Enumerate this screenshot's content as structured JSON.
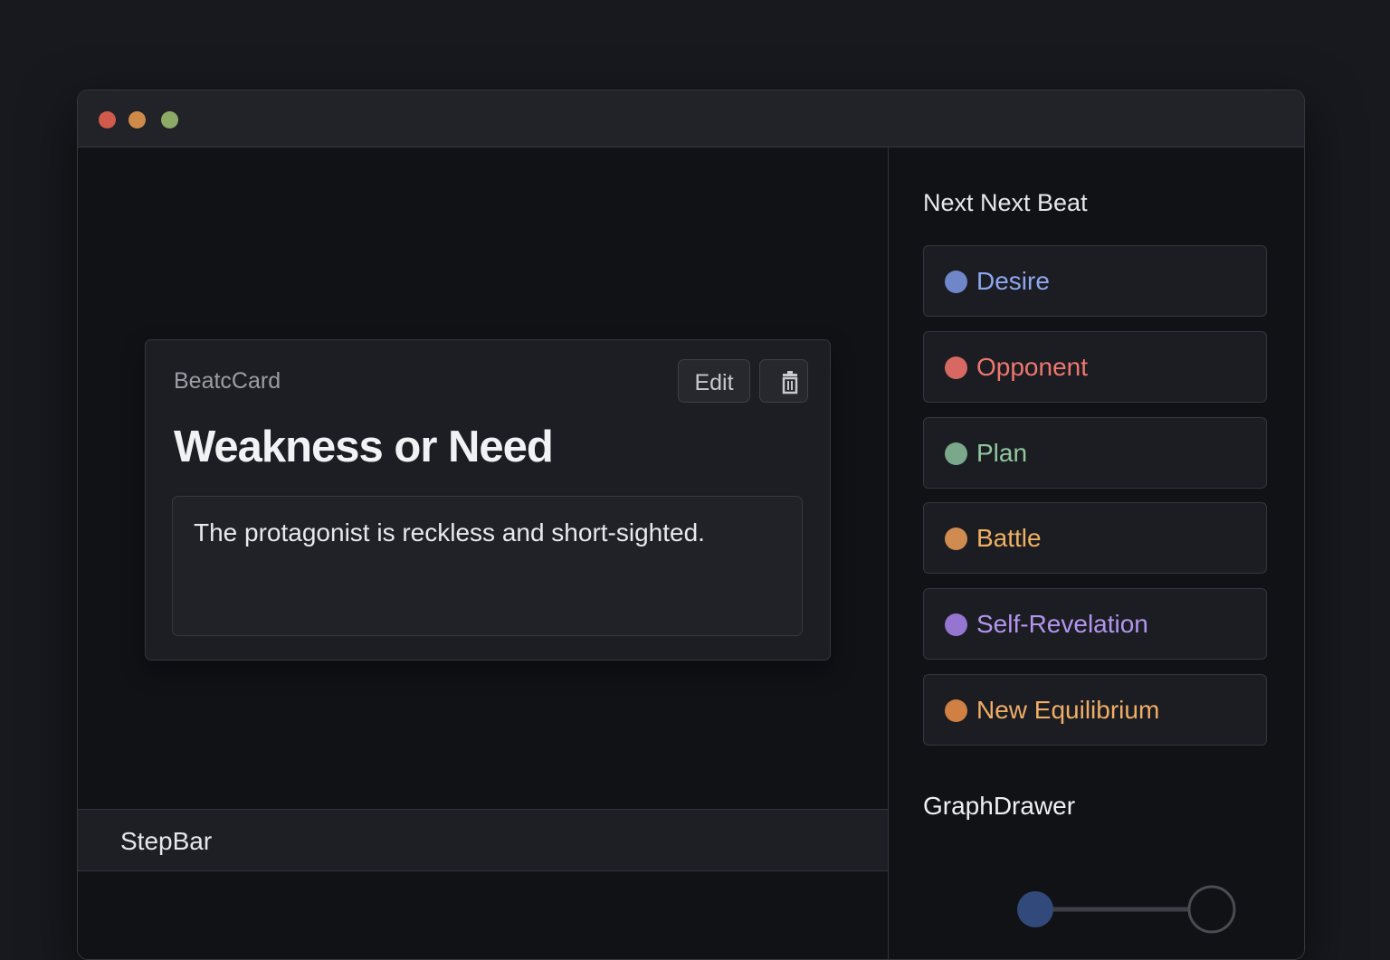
{
  "window": {
    "controls": [
      "close",
      "minimize",
      "maximize"
    ],
    "colors": {
      "close": "#d05a4c",
      "minimize": "#cf8a49",
      "maximize": "#8eaa67"
    }
  },
  "card": {
    "label": "BeatcCard",
    "edit_label": "Edit",
    "delete_icon": "trash-icon",
    "title": "Weakness or Need",
    "text": "The protagonist is reckless and short-sighted."
  },
  "stepbar": {
    "label": "StepBar"
  },
  "sidebar": {
    "title": "Next Next Beat",
    "items": [
      {
        "label": "Desire",
        "dot_color": "#6f87c9",
        "text_color": "#8ea6ef"
      },
      {
        "label": "Opponent",
        "dot_color": "#d86862",
        "text_color": "#ef7770"
      },
      {
        "label": "Plan",
        "dot_color": "#79a98a",
        "text_color": "#91c79e"
      },
      {
        "label": "Battle",
        "dot_color": "#d08c50",
        "text_color": "#f0b062"
      },
      {
        "label": "Self-Revelation",
        "dot_color": "#9475cf",
        "text_color": "#b395ee"
      },
      {
        "label": "New Equilibrium",
        "dot_color": "#cf8042",
        "text_color": "#f0ad67"
      }
    ]
  },
  "graph": {
    "title": "GraphDrawer",
    "colors": {
      "filled_node": "#314a7b",
      "empty_node_border": "#4a4c52",
      "edge": "#3e4046"
    }
  }
}
